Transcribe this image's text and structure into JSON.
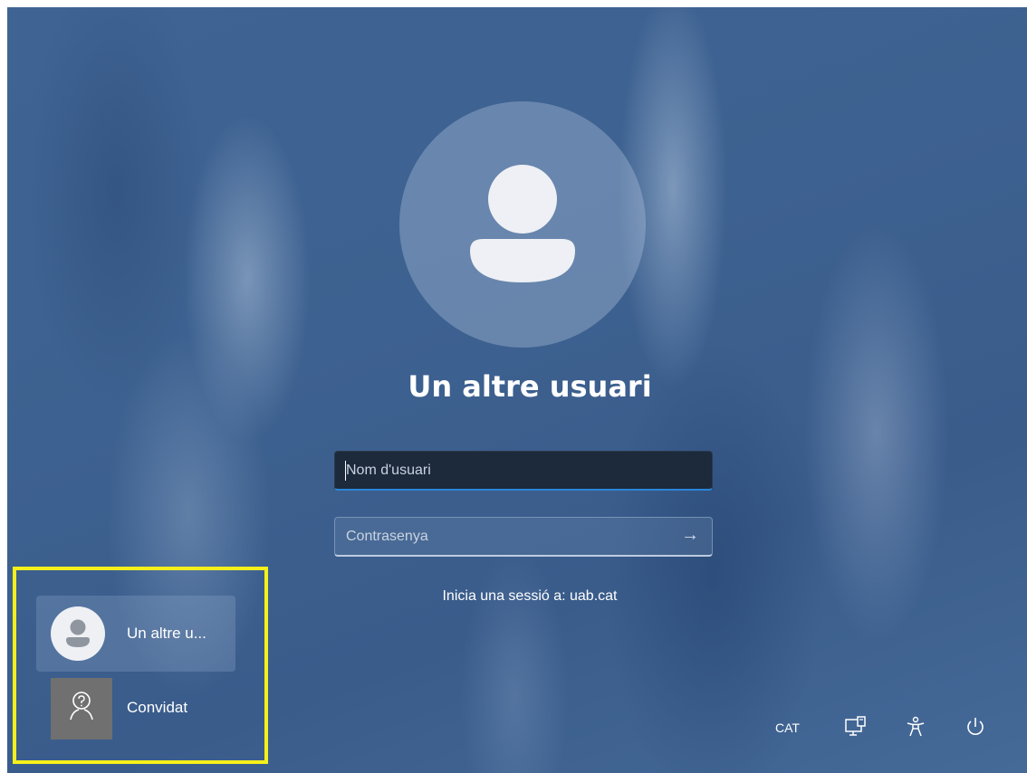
{
  "avatar": {
    "icon": "user-silhouette-icon"
  },
  "title": "Un altre usuari",
  "username_field": {
    "placeholder": "Nom d'usuari"
  },
  "password_field": {
    "placeholder": "Contrasenya",
    "submit_icon": "arrow-right-icon"
  },
  "domain_text": "Inicia una sessió a: uab.cat",
  "user_list": [
    {
      "name": "Un altre u...",
      "icon": "user-silhouette-icon",
      "selected": true
    },
    {
      "name": "Convidat",
      "icon": "guest-person-icon",
      "selected": false
    }
  ],
  "tray": {
    "language": "CAT",
    "icons": [
      "network-monitor-icon",
      "accessibility-icon",
      "power-icon"
    ]
  },
  "colors": {
    "highlight": "#f5ef1b",
    "focus_underline": "#2a86d8"
  }
}
